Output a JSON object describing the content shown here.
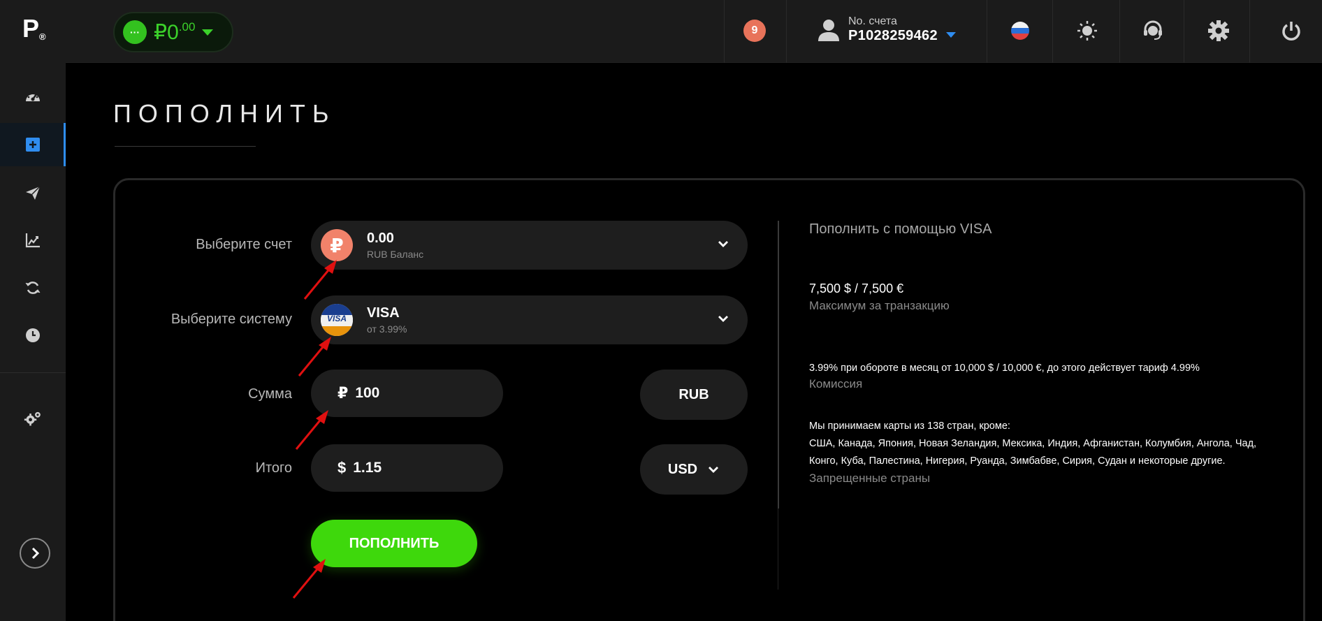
{
  "sidebar": {
    "logo": "P",
    "logo_mark": "®",
    "items": [
      {
        "name": "dashboard",
        "icon": "speedometer-icon"
      },
      {
        "name": "deposit",
        "icon": "plus-square-icon",
        "active": true
      },
      {
        "name": "send",
        "icon": "paper-plane-icon"
      },
      {
        "name": "statistics",
        "icon": "chart-line-icon"
      },
      {
        "name": "exchange",
        "icon": "refresh-icon"
      },
      {
        "name": "history",
        "icon": "clock-icon"
      },
      {
        "name": "settings",
        "icon": "gears-icon"
      }
    ],
    "expand_icon": "chevron-right-icon"
  },
  "header": {
    "balance_symbol": "₽",
    "balance_integer": "0",
    "balance_cents": ".00",
    "balance_dots": "···",
    "notifications_count": "9",
    "account_label": "No. счета",
    "account_number": "P1028259462",
    "language_icon": "russia-flag-icon",
    "theme_icon": "sun-icon",
    "support_icon": "headset-icon",
    "settings_icon": "gear-icon",
    "logout_icon": "power-icon"
  },
  "page": {
    "title": "ПОПОЛНИТЬ"
  },
  "form": {
    "account_label": "Выберите счет",
    "account_value": "0.00",
    "account_sub": "RUB Баланс",
    "account_icon_glyph": "₽",
    "system_label": "Выберите систему",
    "system_value": "VISA",
    "system_sub": "от 3.99%",
    "system_icon_text": "VISA",
    "amount_label": "Сумма",
    "amount_symbol": "₽",
    "amount_value": "100",
    "amount_currency": "RUB",
    "total_label": "Итого",
    "total_symbol": "$",
    "total_value": "1.15",
    "total_currency": "USD",
    "submit_label": "ПОПОЛНИТЬ"
  },
  "info": {
    "title": "Пополнить с помощью VISA",
    "limit_value": "7,500 $ / 7,500 €",
    "limit_label": "Максимум за транзакцию",
    "commission_value": "3.99% при обороте в месяц от 10,000 $ / 10,000 €, до этого действует тариф 4.99%",
    "commission_label": "Комиссия",
    "countries_intro": "Мы принимаем карты из 138 стран, кроме:",
    "countries_line1": "США, Канада, Япония, Новая Зеландия, Мексика, Индия, Афганистан, Колумбия, Ангола, Чад,",
    "countries_line2": "Конго, Куба, Палестина, Нигерия, Руанда, Зимбабве, Сирия, Судан и некоторые другие.",
    "countries_label": "Запрещенные страны"
  },
  "colors": {
    "accent_green": "#3ed80c",
    "accent_blue": "#2f8df0",
    "badge": "#e8735a",
    "annotation_arrow": "#e01010"
  }
}
